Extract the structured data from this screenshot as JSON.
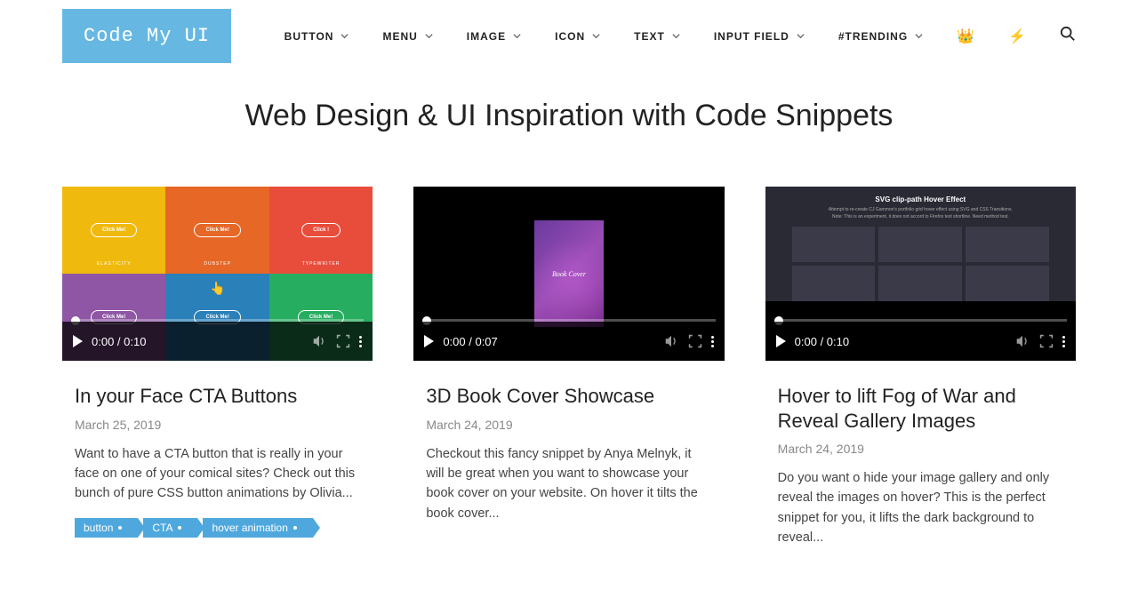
{
  "logo": "Code My UI",
  "nav": [
    {
      "label": "BUTTON"
    },
    {
      "label": "MENU"
    },
    {
      "label": "IMAGE"
    },
    {
      "label": "ICON"
    },
    {
      "label": "TEXT"
    },
    {
      "label": "INPUT FIELD"
    },
    {
      "label": "#TRENDING"
    }
  ],
  "hero_title": "Web Design & UI Inspiration with Code Snippets",
  "cards": [
    {
      "title": "In your Face CTA Buttons",
      "date": "March 25, 2019",
      "desc": "Want to have a CTA button that is really in your face on one of your comical sites? Check out this bunch of pure CSS button animations by Olivia...",
      "time": "0:00 / 0:10",
      "tags": [
        "button",
        "CTA",
        "hover animation"
      ],
      "preview": {
        "cells": [
          {
            "btn": "Click Me!",
            "label": "ELASTICITY"
          },
          {
            "btn": "Click Me!",
            "label": "DUBSTEP"
          },
          {
            "btn": "Click !",
            "label": "TYPEWRITER"
          },
          {
            "btn": "Click Me!",
            "label": ""
          },
          {
            "btn": "Click Me!",
            "label": ""
          },
          {
            "btn": "Click Me!",
            "label": ""
          }
        ]
      }
    },
    {
      "title": "3D Book Cover Showcase",
      "date": "March 24, 2019",
      "desc": "Checkout this fancy snippet by Anya Melnyk, it will be great when you want to showcase your book cover on your website. On hover it tilts the book cover...",
      "time": "0:00 / 0:07",
      "preview": {
        "book_text": "Book Cover"
      }
    },
    {
      "title": "Hover to lift Fog of War and Reveal Gallery Images",
      "date": "March 24, 2019",
      "desc": "Do you want o hide your image gallery and only reveal the images on hover? This is the perfect snippet for you, it lifts the dark background to reveal...",
      "time": "0:00 / 0:10",
      "preview": {
        "title": "SVG clip-path Hover Effect",
        "sub1": "Attempt to re-create CJ Gammon's portfolio grid hover effect using SVG and CSS Transitions.",
        "sub2": "Note: This is an experiment, it does not accord to Firefox test shortline. Need method test."
      }
    }
  ]
}
